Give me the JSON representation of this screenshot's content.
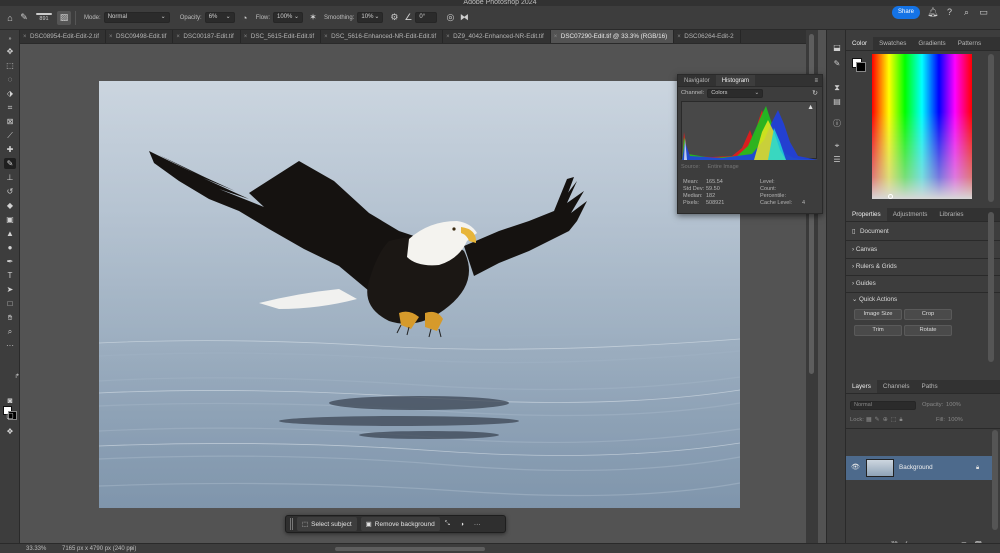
{
  "app": {
    "title": "Adobe Photoshop 2024"
  },
  "options_bar": {
    "brush_size": "891",
    "mode_label": "Mode:",
    "mode_value": "Normal",
    "opacity_label": "Opacity:",
    "opacity_value": "6%",
    "flow_label": "Flow:",
    "flow_value": "100%",
    "smoothing_label": "Smoothing:",
    "smoothing_value": "10%",
    "angle_value": "0°",
    "share_label": "Share"
  },
  "tabs": [
    {
      "label": "DSC08954-Edit-Edit-2.tif",
      "active": false
    },
    {
      "label": "DSC09498-Edit.tif",
      "active": false
    },
    {
      "label": "DSC00187-Edit.tif",
      "active": false
    },
    {
      "label": "DSC_5615-Edit-Edit.tif",
      "active": false
    },
    {
      "label": "DSC_5616-Enhanced-NR-Edit-Edit.tif",
      "active": false
    },
    {
      "label": "DZ9_4042-Enhanced-NR-Edit.tif",
      "active": false
    },
    {
      "label": "DSC07290-Edit.tif @ 33.3% (RGB/16)",
      "active": true
    },
    {
      "label": "DSC06264-Edit-2",
      "active": false
    }
  ],
  "histogram_panel": {
    "tabs": [
      "Navigator",
      "Histogram"
    ],
    "active_tab": "Histogram",
    "channel_label": "Channel:",
    "channel_value": "Colors",
    "source_label": "Source:",
    "source_value": "Entire Image",
    "stats": {
      "mean_label": "Mean:",
      "mean_value": "165.54",
      "std_dev_label": "Std Dev:",
      "std_dev_value": "59.50",
      "median_label": "Median:",
      "median_value": "182",
      "pixels_label": "Pixels:",
      "pixels_value": "508921",
      "level_label": "Level:",
      "count_label": "Count:",
      "percentile_label": "Percentile:",
      "cache_level_label": "Cache Level:",
      "cache_level_value": "4"
    }
  },
  "color_panel": {
    "tabs": [
      "Color",
      "Swatches",
      "Gradients",
      "Patterns"
    ],
    "active_tab": "Color",
    "foreground": "#ffffff",
    "background": "#000000"
  },
  "properties_panel": {
    "tabs": [
      "Properties",
      "Adjustments",
      "Libraries"
    ],
    "active_tab": "Properties",
    "document_label": "Document",
    "sections": [
      "Canvas",
      "Rulers & Grids",
      "Guides"
    ],
    "quick_actions_label": "Quick Actions",
    "quick_actions": [
      "Image Size",
      "Crop",
      "Trim",
      "Rotate"
    ]
  },
  "layers_panel": {
    "tabs": [
      "Layers",
      "Channels",
      "Paths"
    ],
    "active_tab": "Layers",
    "blend_mode": "Normal",
    "opacity_label": "Opacity:",
    "opacity_value": "100%",
    "lock_label": "Lock:",
    "fill_label": "Fill:",
    "fill_value": "100%",
    "layers": [
      {
        "name": "Background",
        "visible": true,
        "locked": true,
        "selected": true
      }
    ]
  },
  "taskbar": {
    "select_subject_label": "Select subject",
    "remove_background_label": "Remove background",
    "more_label": "···"
  },
  "status_bar": {
    "zoom": "33.33%",
    "doc_info": "7165 px x 4790 px (240 ppi)"
  },
  "icons": {
    "toolbar": [
      "move-icon",
      "artboard-icon",
      "lasso-icon",
      "object-select-icon",
      "crop-icon",
      "frame-icon",
      "eyedropper-icon",
      "healing-icon",
      "brush-icon",
      "stamp-icon",
      "history-brush-icon",
      "eraser-icon",
      "gradient-icon",
      "blur-icon",
      "dodge-icon",
      "pen-icon",
      "type-icon",
      "path-select-icon",
      "rectangle-icon",
      "hand-icon",
      "zoom-icon",
      "more-tools-icon"
    ]
  }
}
